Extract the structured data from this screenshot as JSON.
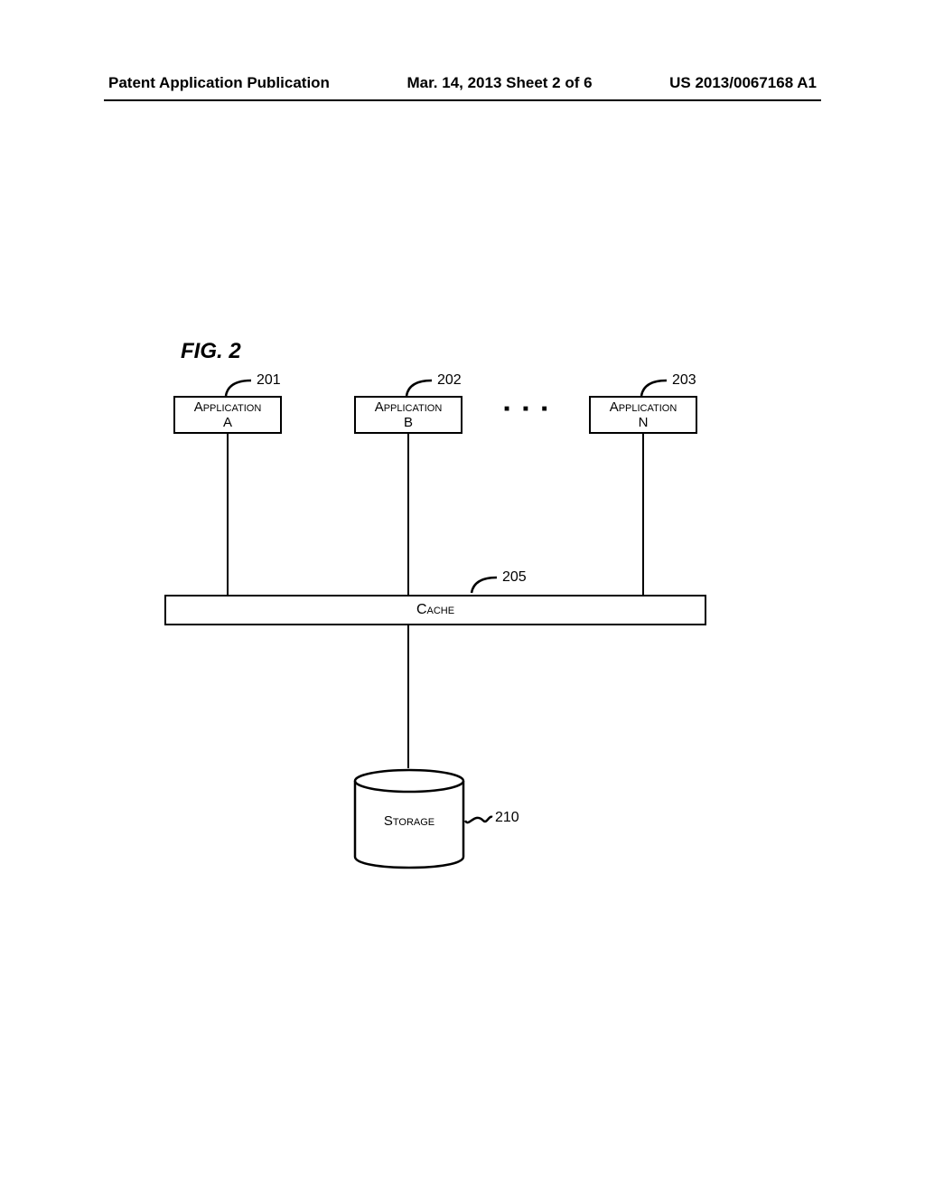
{
  "header": {
    "left": "Patent Application Publication",
    "center": "Mar. 14, 2013  Sheet 2 of 6",
    "right": "US 2013/0067168 A1"
  },
  "figure": {
    "title": "FIG. 2"
  },
  "refs": {
    "app_a": "201",
    "app_b": "202",
    "app_n": "203",
    "cache": "205",
    "storage": "210"
  },
  "blocks": {
    "app_a_l1": "Application",
    "app_a_l2": "A",
    "app_b_l1": "Application",
    "app_b_l2": "B",
    "app_n_l1": "Application",
    "app_n_l2": "N",
    "cache": "Cache",
    "storage": "Storage",
    "dots": "■ ■ ■"
  }
}
